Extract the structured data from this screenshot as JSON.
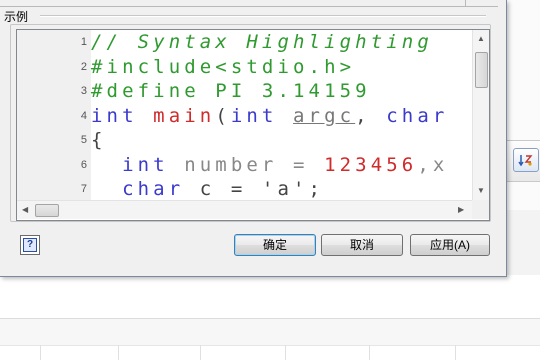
{
  "dialog": {
    "group_label": "示例",
    "code_lines": [
      {
        "n": "1",
        "tokens": [
          {
            "text": "// Syntax Highlighting ",
            "cls": "t-comment"
          }
        ]
      },
      {
        "n": "2",
        "tokens": [
          {
            "text": "#include<stdio.h>",
            "cls": "t-green"
          }
        ]
      },
      {
        "n": "3",
        "tokens": [
          {
            "text": "#define PI 3.14159",
            "cls": "t-green"
          }
        ]
      },
      {
        "n": "4",
        "tokens": [
          {
            "text": "int ",
            "cls": "t-blue"
          },
          {
            "text": "main",
            "cls": "t-red"
          },
          {
            "text": "(",
            "cls": "t-plain"
          },
          {
            "text": "int ",
            "cls": "t-blue"
          },
          {
            "text": "argc",
            "cls": "t-under"
          },
          {
            "text": ", ",
            "cls": "t-plain"
          },
          {
            "text": "char",
            "cls": "t-blue"
          }
        ]
      },
      {
        "n": "5",
        "tokens": [
          {
            "text": "{",
            "cls": "t-plain"
          }
        ]
      },
      {
        "n": "6",
        "tokens": [
          {
            "text": "  int ",
            "cls": "t-blue"
          },
          {
            "text": "number = ",
            "cls": "t-gray"
          },
          {
            "text": "123456",
            "cls": "t-red"
          },
          {
            "text": ",x",
            "cls": "t-gray"
          }
        ]
      },
      {
        "n": "7",
        "tokens": [
          {
            "text": "  char ",
            "cls": "t-blue"
          },
          {
            "text": "c = 'a';",
            "cls": "t-plain"
          }
        ]
      }
    ],
    "buttons": {
      "ok": "确定",
      "cancel": "取消",
      "apply": "应用(A)",
      "help": "?"
    }
  },
  "colors": {
    "comment": "#2f9a2f",
    "keyword": "#3a3acc",
    "literal": "#d02a2a"
  }
}
